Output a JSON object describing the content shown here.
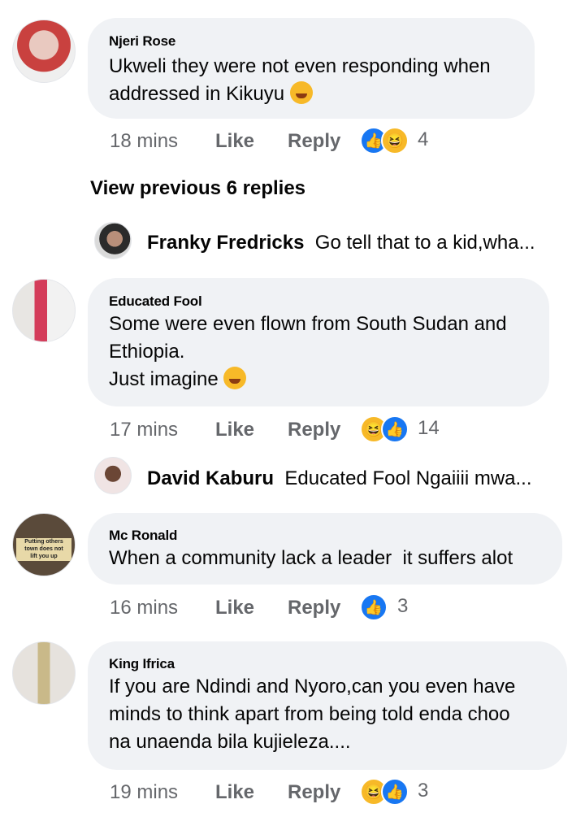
{
  "comments": [
    {
      "author": "Njeri Rose",
      "lines": [
        "Ukweli they were not even responding when",
        "addressed in Kikuyu"
      ],
      "emoji": "laughing-emoji",
      "time": "18 mins",
      "like": "Like",
      "reply": "Reply",
      "reactions": [
        "like",
        "haha"
      ],
      "reaction_count": "4"
    },
    {
      "author": "Educated Fool",
      "lines": [
        "Some were even flown from South Sudan and",
        "Ethiopia.",
        "Just imagine"
      ],
      "emoji": "tongue-emoji",
      "time": "17 mins",
      "like": "Like",
      "reply": "Reply",
      "reactions": [
        "haha",
        "like"
      ],
      "reaction_count": "14"
    },
    {
      "author": "Mc Ronald",
      "lines": [
        "When a community lack a leader  it suffers alot"
      ],
      "time": "16 mins",
      "like": "Like",
      "reply": "Reply",
      "reactions": [
        "like"
      ],
      "reaction_count": "3",
      "avatar_text": [
        "Putting others",
        "town does not",
        "lift you up"
      ]
    },
    {
      "author": "King Ifrica",
      "lines": [
        "If you are Ndindi and Nyoro,can you even have",
        "minds to think apart from being told enda choo",
        "na unaenda bila kujieleza...."
      ],
      "time": "19 mins",
      "like": "Like",
      "reply": "Reply",
      "reactions": [
        "haha",
        "like"
      ],
      "reaction_count": "3"
    }
  ],
  "view_previous": "View previous 6 replies",
  "replies": [
    {
      "name": "Franky Fredricks",
      "text": "Go tell that to a kid,wha..."
    },
    {
      "name": "David Kaburu",
      "text": "Educated Fool Ngaiiii mwa..."
    }
  ],
  "colors": {
    "bubble": "#f0f2f5",
    "meta": "#65676b",
    "like_blue": "#1877f2",
    "haha_yellow": "#f7b928"
  }
}
